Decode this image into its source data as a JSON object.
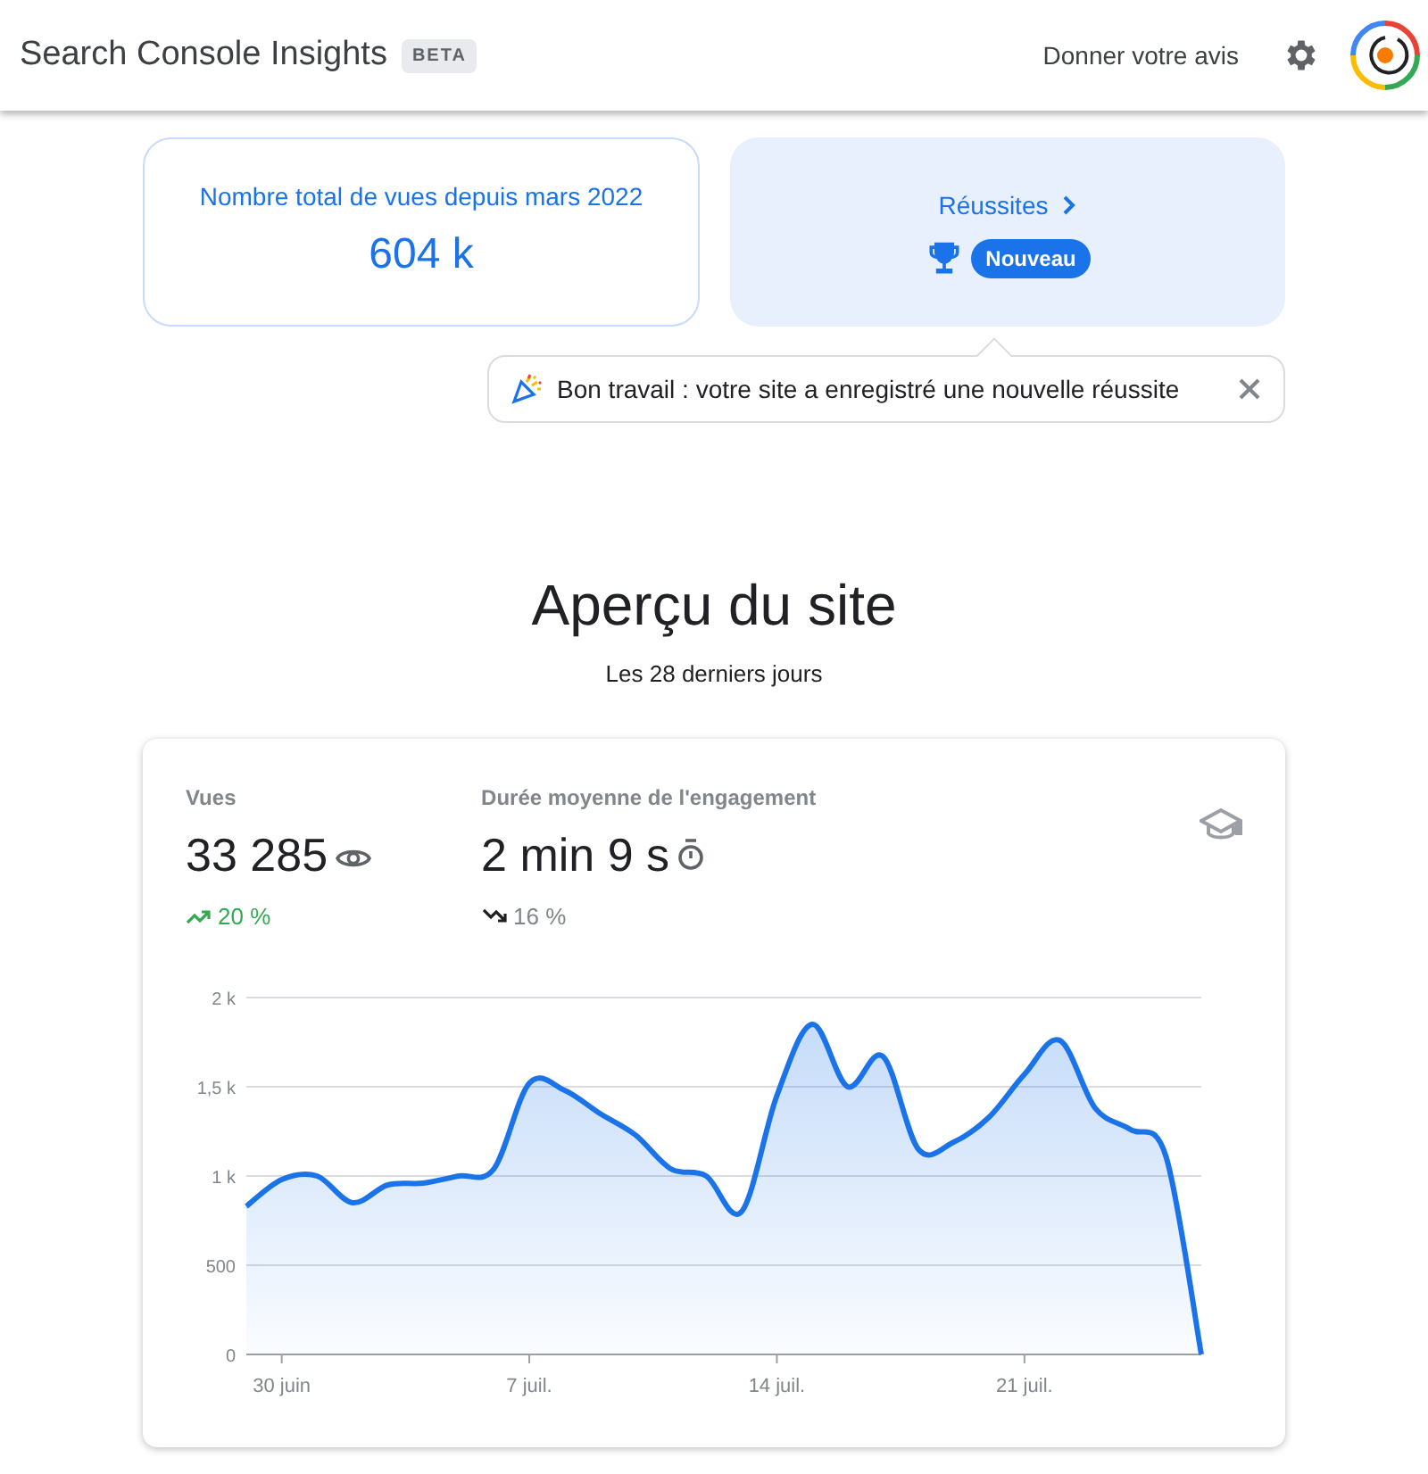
{
  "header": {
    "title": "Search Console Insights",
    "badge": "BETA",
    "feedback": "Donner votre avis"
  },
  "highlights": {
    "total_views": {
      "label": "Nombre total de vues depuis mars 2022",
      "value": "604 k"
    },
    "achievements": {
      "label": "Réussites",
      "badge": "Nouveau"
    },
    "notification": {
      "message": "Bon travail : votre site a enregistré une nouvelle réussite"
    }
  },
  "overview": {
    "title": "Aperçu du site",
    "subtitle": "Les 28 derniers jours",
    "metrics": [
      {
        "label": "Vues",
        "value": "33 285",
        "kind": "up",
        "change": "20 %"
      },
      {
        "label": "Durée moyenne de l'engagement",
        "value": "2 min 9 s",
        "kind": "down",
        "change": "16 %"
      }
    ],
    "chart_data": {
      "type": "area",
      "categories": [
        null,
        "30 juin",
        null,
        null,
        null,
        null,
        null,
        null,
        "7 juil.",
        null,
        null,
        null,
        null,
        null,
        null,
        "14 juil.",
        null,
        null,
        null,
        null,
        null,
        null,
        "21 juil.",
        null,
        null,
        null,
        null,
        null
      ],
      "series": [
        {
          "color": "#1a73e8",
          "values": [
            830,
            980,
            1000,
            850,
            950,
            960,
            1000,
            1040,
            1520,
            1480,
            1350,
            1230,
            1040,
            1000,
            800,
            1450,
            1850,
            1500,
            1670,
            1150,
            1190,
            1330,
            1570,
            1760,
            1380,
            1260,
            1110,
            0
          ]
        }
      ],
      "yticks": [
        {
          "value": 0,
          "label": "0"
        },
        {
          "value": 500,
          "label": "500"
        },
        {
          "value": 1000,
          "label": "1 k"
        },
        {
          "value": 1500,
          "label": "1,5 k"
        },
        {
          "value": 2000,
          "label": "2 k"
        }
      ],
      "ylim": [
        0,
        2000
      ],
      "grid": true
    }
  }
}
